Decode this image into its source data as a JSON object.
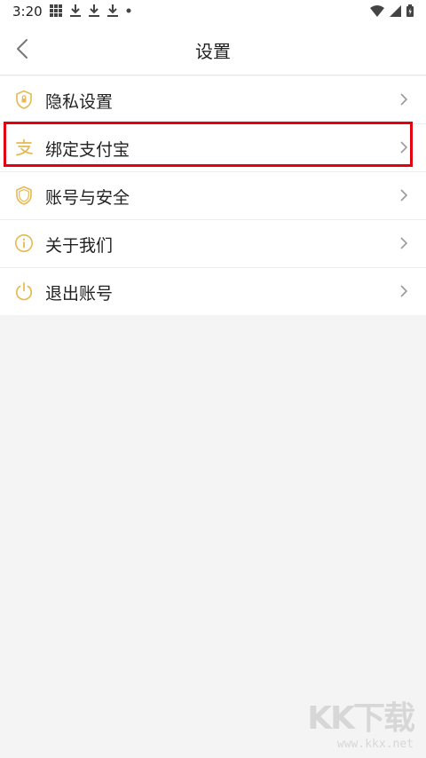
{
  "status_bar": {
    "time": "3:20",
    "notification_icons": [
      "grid-icon",
      "download-icon",
      "download-icon",
      "download-icon",
      "dot-icon"
    ],
    "system_icons": [
      "wifi-icon",
      "signal-icon",
      "battery-icon"
    ]
  },
  "header": {
    "title": "设置",
    "back_icon": "chevron-left-icon"
  },
  "menu": {
    "items": [
      {
        "label": "隐私设置",
        "icon": "shield-lock-icon"
      },
      {
        "label": "绑定支付宝",
        "icon": "alipay-icon"
      },
      {
        "label": "账号与安全",
        "icon": "shield-icon"
      },
      {
        "label": "关于我们",
        "icon": "info-icon"
      },
      {
        "label": "退出账号",
        "icon": "power-icon"
      }
    ]
  },
  "colors": {
    "icon_accent": "#e7b94e",
    "highlight_border": "#e3000f",
    "background": "#f4f4f4"
  },
  "watermark": {
    "logo": "KK下载",
    "url": "www.kkx.net"
  }
}
